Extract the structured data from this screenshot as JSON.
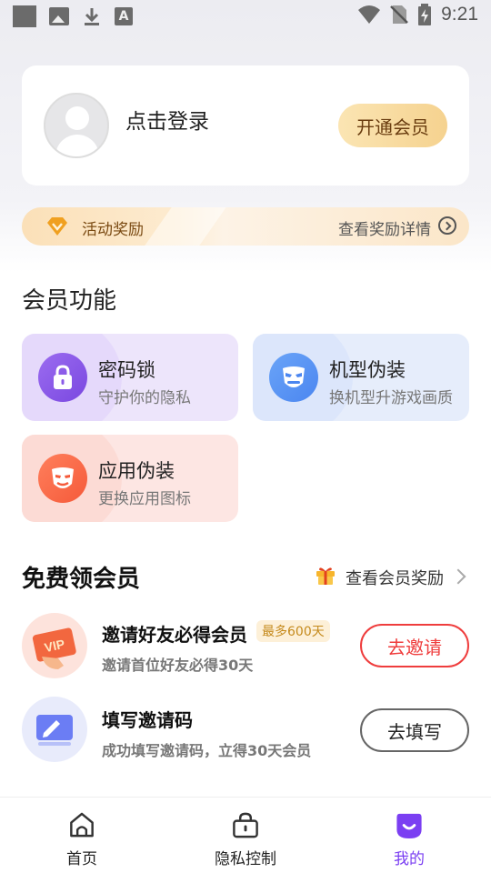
{
  "status_bar": {
    "time": "9:21"
  },
  "login_card": {
    "prompt": "点击登录",
    "vip_button": "开通会员"
  },
  "activity": {
    "label": "活动奖励",
    "link": "查看奖励详情"
  },
  "member_features": {
    "title": "会员功能",
    "items": [
      {
        "title": "密码锁",
        "subtitle": "守护你的隐私",
        "icon": "lock-icon"
      },
      {
        "title": "机型伪装",
        "subtitle": "换机型升游戏画质",
        "icon": "mask-icon"
      },
      {
        "title": "应用伪装",
        "subtitle": "更换应用图标",
        "icon": "app-mask-icon"
      }
    ]
  },
  "free_vip": {
    "title": "免费领会员",
    "link": "查看会员奖励",
    "tasks": [
      {
        "title": "邀请好友必得会员",
        "badge": "最多600天",
        "subtitle": "邀请首位好友必得30天",
        "button": "去邀请",
        "icon_text": "VIP"
      },
      {
        "title": "填写邀请码",
        "subtitle": "成功填写邀请码，立得30天会员",
        "button": "去填写"
      }
    ]
  },
  "bottom_nav": {
    "items": [
      {
        "label": "首页",
        "icon": "home-icon"
      },
      {
        "label": "隐私控制",
        "icon": "lock-bag-icon"
      },
      {
        "label": "我的",
        "icon": "profile-icon",
        "active": true
      }
    ],
    "active_color": "#7b3ff2"
  }
}
